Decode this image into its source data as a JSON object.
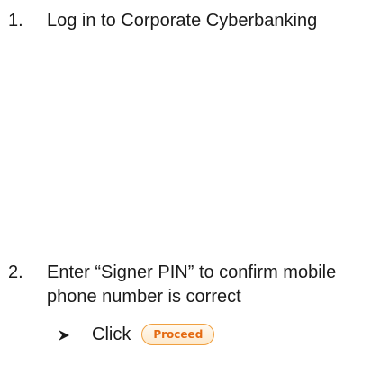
{
  "steps": [
    {
      "number": "1.",
      "text": "Log in to Corporate Cyberbanking"
    },
    {
      "number": "2.",
      "text": "Enter “Signer PIN” to confirm mobile phone number is correct"
    }
  ],
  "sub_bullet": {
    "icon": "arrow-bullet-icon",
    "click_label": "Click",
    "button_label": "Proceed"
  },
  "colors": {
    "button_text": "#e46a12",
    "button_border": "#f0a040",
    "body_text": "#1a1a1a"
  }
}
